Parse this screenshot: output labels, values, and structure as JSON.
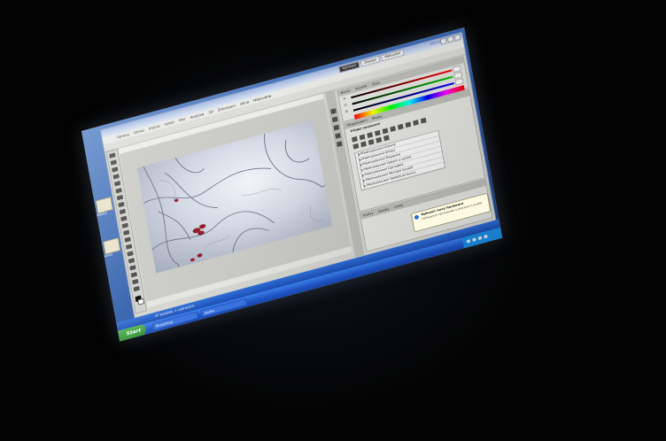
{
  "workspace": {
    "tabs": [
      "Výchozí",
      "Design",
      "Malování"
    ],
    "active_tab": "Výchozí",
    "cslive": "CS Live"
  },
  "menubar": {
    "items": [
      "Úpravy",
      "Obraz",
      "Vrstva",
      "Výběr",
      "Filtr",
      "Analýza",
      "3D",
      "Zobrazení",
      "Okna",
      "Nápověda"
    ]
  },
  "panels": {
    "color": {
      "tabs": [
        "Barva",
        "Vzorník",
        "Styly"
      ],
      "channels": [
        "R",
        "G",
        "B"
      ],
      "channel_colors": [
        "#d03a3a",
        "#3aa03a",
        "#3a5ad0"
      ]
    },
    "adjustments": {
      "tabs": [
        "Přizpůsobení",
        "Masky"
      ],
      "heading": "Přidat nastavení",
      "presets": [
        "Přednastavení Úrovně",
        "Přednastavení Křivky",
        "Přednastavení Expozice",
        "Přednastavení Odstín a sytost",
        "Přednastavení Černobílá",
        "Přednastavení Míchání kanálů",
        "Přednastavení Selektivní barva"
      ]
    },
    "layers": {
      "tabs": [
        "Vrstvy",
        "Kanály",
        "Cesty"
      ]
    }
  },
  "balloon": {
    "title": "Nalezen nový hardware",
    "text": "Hardware je nainstalován a připraven k použití."
  },
  "explorer_bar": {
    "text": "47 položek, 1 vybraných"
  },
  "taskbar": {
    "start": "Start",
    "items": [
      "Photoshop",
      "Složka"
    ]
  },
  "desktop": {
    "icons": [
      "Adobe",
      "Adob"
    ]
  }
}
